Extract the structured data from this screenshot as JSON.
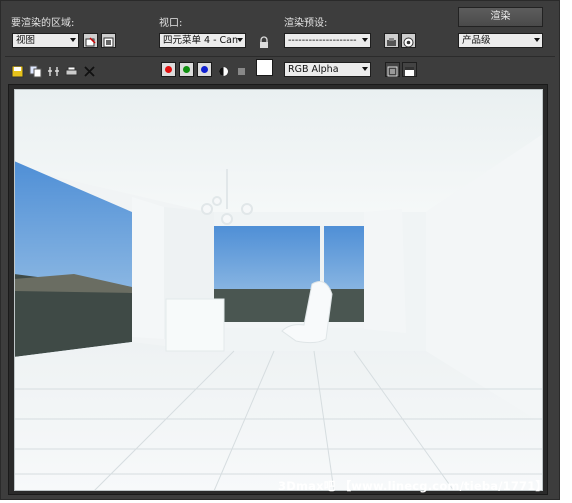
{
  "panel": {
    "area_label": "要渲染的区域:",
    "area_value": "视图",
    "viewport_label": "视口:",
    "viewport_value": "四元菜单 4 - Can",
    "preset_label": "渲染预设:",
    "preset_value": "--------------------",
    "render_button": "渲染",
    "quality_value": "产品级"
  },
  "toolbar": {
    "channel_value": "RGB Alpha",
    "channels": [
      {
        "name": "red-channel",
        "color": "#e01010"
      },
      {
        "name": "green-channel",
        "color": "#109010"
      },
      {
        "name": "blue-channel",
        "color": "#1020d0"
      }
    ]
  },
  "watermark": "3Dmax吧 【www.linecg.com/tieba/1771】"
}
